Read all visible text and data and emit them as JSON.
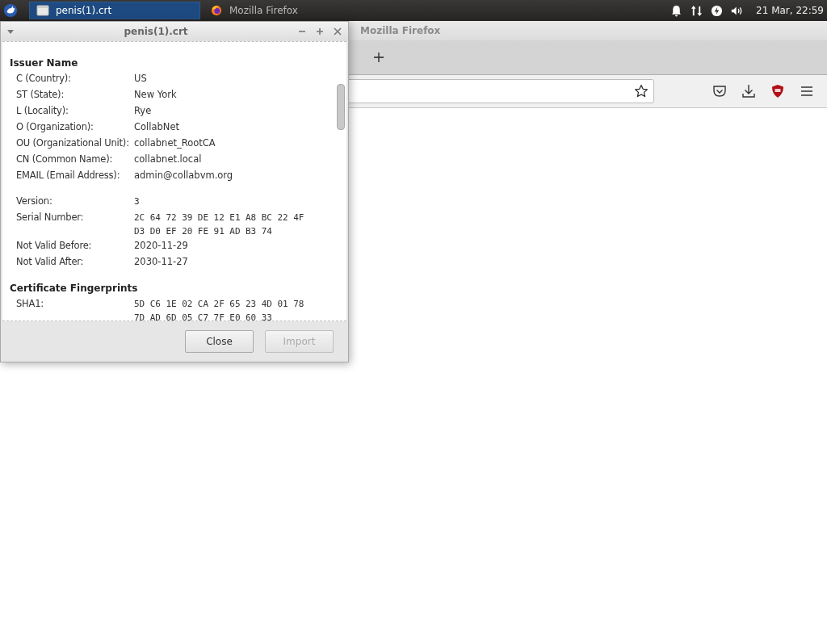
{
  "taskbar": {
    "tasks": [
      {
        "title": "penis(1).crt",
        "kind": "document",
        "selected": true
      },
      {
        "title": "Mozilla Firefox",
        "kind": "firefox",
        "selected": false
      }
    ],
    "clock": "21 Mar, 22:59"
  },
  "browser": {
    "window": {
      "title": "Mozilla Firefox"
    }
  },
  "dialog": {
    "window": {
      "title": "penis(1).crt"
    },
    "sections": [
      {
        "title": "Issuer Name",
        "rows": [
          {
            "label": "C (Country):",
            "value": "US",
            "kind": "text"
          },
          {
            "label": "ST (State):",
            "value": "New York",
            "kind": "text"
          },
          {
            "label": "L (Locality):",
            "value": "Rye",
            "kind": "text"
          },
          {
            "label": "O (Organization):",
            "value": "CollabNet",
            "kind": "text"
          },
          {
            "label": "OU (Organizational Unit):",
            "value": "collabnet_RootCA",
            "kind": "text"
          },
          {
            "label": "CN (Common Name):",
            "value": "collabnet.local",
            "kind": "text"
          },
          {
            "label": "EMAIL (Email Address):",
            "value": "admin@collabvm.org",
            "kind": "text"
          }
        ]
      },
      {
        "rows": [
          {
            "label": "Version:",
            "value": "3",
            "kind": "mono"
          },
          {
            "label": "Serial Number:",
            "value": "2C 64 72 39 DE 12 E1 A8 BC 22 4F D3 D0 EF 20 FE 91 AD B3 74",
            "kind": "mono"
          },
          {
            "label": "Not Valid Before:",
            "value": "2020-11-29",
            "kind": "text"
          },
          {
            "label": "Not Valid After:",
            "value": "2030-11-27",
            "kind": "text"
          }
        ]
      },
      {
        "title": "Certificate Fingerprints",
        "rows": [
          {
            "label": "SHA1:",
            "value": "5D C6 1E 02 CA 2F 65 23 4D 01 78 7D AD 6D 05 C7 7F E0 60 33",
            "kind": "mono"
          }
        ]
      }
    ],
    "buttons": [
      {
        "label": "Close",
        "disabled": false
      },
      {
        "label": "Import",
        "disabled": true
      }
    ]
  }
}
